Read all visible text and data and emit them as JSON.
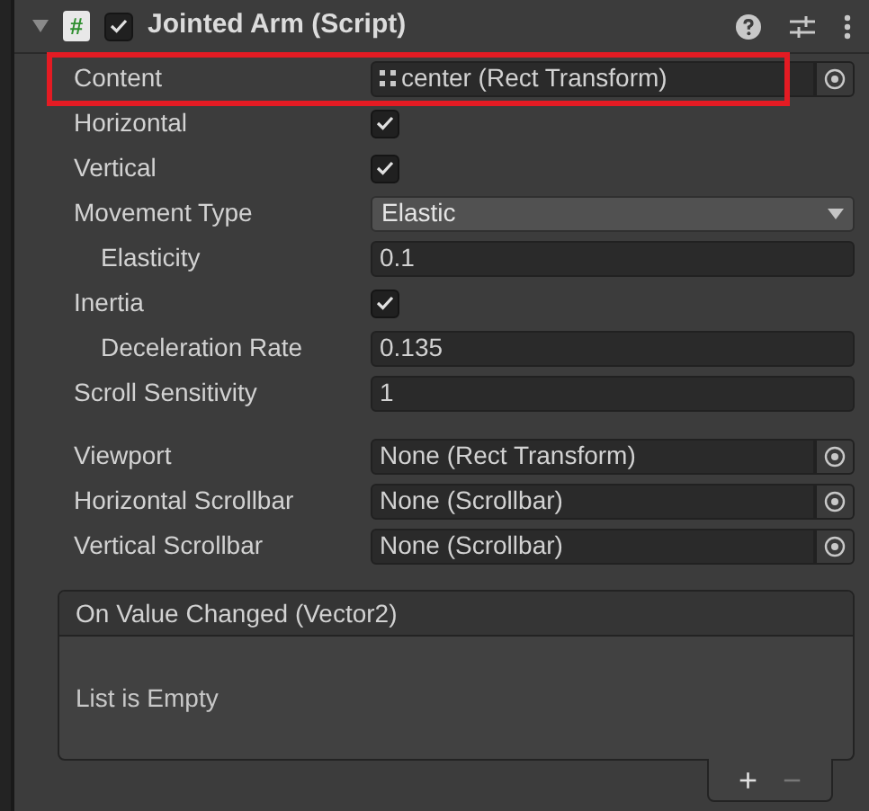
{
  "component": {
    "title": "Jointed Arm (Script)",
    "expanded": true,
    "enabled": true,
    "script_icon": "#"
  },
  "fields": [
    {
      "kind": "object",
      "label": "Content",
      "value": "center (Rect Transform)",
      "highlighted": true,
      "prefix_icon": true
    },
    {
      "kind": "toggle",
      "label": "Horizontal",
      "checked": true
    },
    {
      "kind": "toggle",
      "label": "Vertical",
      "checked": true
    },
    {
      "kind": "dropdown",
      "label": "Movement Type",
      "value": "Elastic",
      "children": [
        {
          "kind": "number",
          "label": "Elasticity",
          "value": "0.1"
        }
      ]
    },
    {
      "kind": "toggle",
      "label": "Inertia",
      "checked": true,
      "children": [
        {
          "kind": "number",
          "label": "Deceleration Rate",
          "value": "0.135"
        }
      ]
    },
    {
      "kind": "number",
      "label": "Scroll Sensitivity",
      "value": "1"
    },
    {
      "kind": "spacer"
    },
    {
      "kind": "object",
      "label": "Viewport",
      "value": "None (Rect Transform)",
      "highlighted": false,
      "prefix_icon": false
    },
    {
      "kind": "object",
      "label": "Horizontal Scrollbar",
      "value": "None (Scrollbar)",
      "highlighted": false,
      "prefix_icon": false
    },
    {
      "kind": "object",
      "label": "Vertical Scrollbar",
      "value": "None (Scrollbar)",
      "highlighted": false,
      "prefix_icon": false
    }
  ],
  "event": {
    "title": "On Value Changed (Vector2)",
    "empty_text": "List is Empty",
    "add_label": "+",
    "remove_label": "−",
    "remove_disabled": true
  }
}
